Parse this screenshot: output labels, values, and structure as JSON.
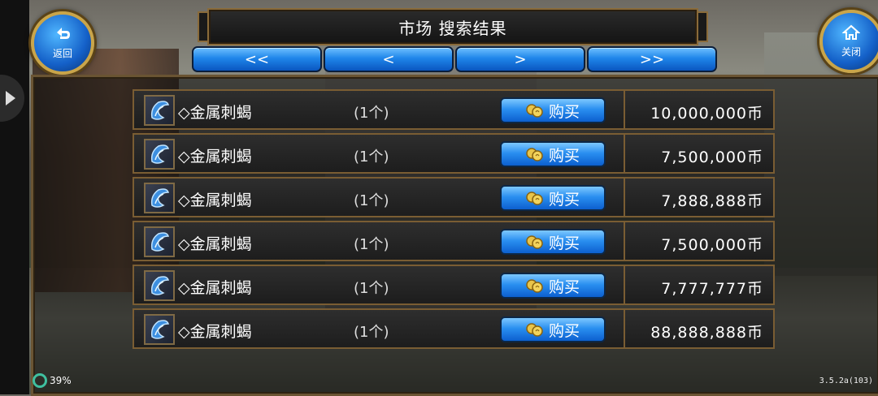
{
  "header": {
    "title": "市场  搜索结果",
    "back_label": "返回",
    "close_label": "关闭"
  },
  "pager": {
    "first": "<<",
    "prev": "<",
    "next": ">",
    "last": ">>"
  },
  "listings": [
    {
      "name": "◇金属刺蝎",
      "qty": "(1个)",
      "buy_label": "购买",
      "price": "10,000,000币"
    },
    {
      "name": "◇金属刺蝎",
      "qty": "(1个)",
      "buy_label": "购买",
      "price": "7,500,000币"
    },
    {
      "name": "◇金属刺蝎",
      "qty": "(1个)",
      "buy_label": "购买",
      "price": "7,888,888币"
    },
    {
      "name": "◇金属刺蝎",
      "qty": "(1个)",
      "buy_label": "购买",
      "price": "7,500,000币"
    },
    {
      "name": "◇金属刺蝎",
      "qty": "(1个)",
      "buy_label": "购买",
      "price": "7,777,777币"
    },
    {
      "name": "◇金属刺蝎",
      "qty": "(1个)",
      "buy_label": "购买",
      "price": "88,888,888币"
    }
  ],
  "status": {
    "battery": "39%",
    "version": "3.5.2a(103)"
  },
  "icons": {
    "back": "back-arrow-icon",
    "close": "home-icon",
    "item": "blue-scorpion-blade-icon",
    "coin": "gold-coin-icon"
  },
  "colors": {
    "button_blue": "#1f86ea",
    "frame_gold": "#8a6b3a",
    "panel_dark": "#1d1d1d"
  }
}
